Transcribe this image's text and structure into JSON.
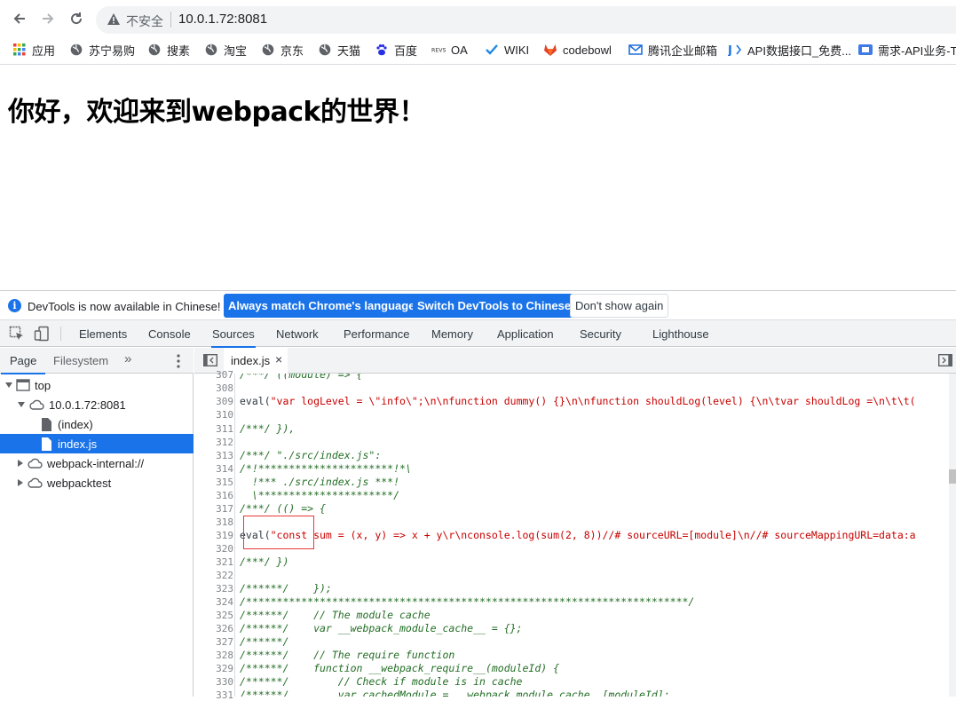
{
  "browser": {
    "security_label": "不安全",
    "url": "10.0.1.72:8081"
  },
  "bookmarks": [
    {
      "label": "应用",
      "icon": "apps-grid-icon"
    },
    {
      "label": "苏宁易购",
      "icon": "globe-icon"
    },
    {
      "label": "搜素",
      "icon": "globe-icon"
    },
    {
      "label": "淘宝",
      "icon": "globe-icon"
    },
    {
      "label": "京东",
      "icon": "globe-icon"
    },
    {
      "label": "天猫",
      "icon": "globe-icon"
    },
    {
      "label": "百度",
      "icon": "baidu-paw-icon"
    },
    {
      "label": "OA",
      "icon": "oa-logo-icon"
    },
    {
      "label": "WIKI",
      "icon": "check-logo-icon"
    },
    {
      "label": "codebowl",
      "icon": "gitlab-fox-icon"
    },
    {
      "label": "腾讯企业邮箱",
      "icon": "tencent-mail-icon"
    },
    {
      "label": "API数据接口_免费...",
      "icon": "api-logo-icon"
    },
    {
      "label": "需求-API业务-T...",
      "icon": "tapd-logo-icon"
    }
  ],
  "page": {
    "heading": "你好，欢迎来到webpack的世界！"
  },
  "devtools": {
    "banner": {
      "message": "DevTools is now available in Chinese!",
      "btn_match": "Always match Chrome's language",
      "btn_switch": "Switch DevTools to Chinese",
      "btn_dismiss": "Don't show again"
    },
    "tabs": [
      "Elements",
      "Console",
      "Sources",
      "Network",
      "Performance",
      "Memory",
      "Application",
      "Security",
      "Lighthouse"
    ],
    "active_tab": "Sources",
    "navigator": {
      "tabs": [
        "Page",
        "Filesystem"
      ],
      "more": "»",
      "tree": {
        "top": "top",
        "host": "10.0.1.72:8081",
        "index": "(index)",
        "indexjs": "index.js",
        "internal": "webpack-internal://",
        "test": "webpacktest"
      }
    },
    "editor": {
      "file_tab": "index.js",
      "close": "×",
      "lines": [
        {
          "n": "307",
          "t": "/***/ ((module) => {"
        },
        {
          "n": "308",
          "t": ""
        },
        {
          "n": "309",
          "t": "eval(\"var logLevel = \\\"info\\\";\\n\\nfunction dummy() {}\\n\\nfunction shouldLog(level) {\\n\\tvar shouldLog =\\n\\t\\t("
        },
        {
          "n": "310",
          "t": ""
        },
        {
          "n": "311",
          "t": "/***/ }),"
        },
        {
          "n": "312",
          "t": ""
        },
        {
          "n": "313",
          "t": "/***/ \"./src/index.js\":"
        },
        {
          "n": "314",
          "t": "/*!**********************!*\\"
        },
        {
          "n": "315",
          "t": "  !*** ./src/index.js ***!"
        },
        {
          "n": "316",
          "t": "  \\**********************/"
        },
        {
          "n": "317",
          "t": "/***/ (() => {"
        },
        {
          "n": "318",
          "t": ""
        },
        {
          "n": "319",
          "t": "eval(\"const sum = (x, y) => x + y\\r\\nconsole.log(sum(2, 8))//# sourceURL=[module]\\n//# sourceMappingURL=data:a"
        },
        {
          "n": "320",
          "t": ""
        },
        {
          "n": "321",
          "t": "/***/ })"
        },
        {
          "n": "322",
          "t": ""
        },
        {
          "n": "323",
          "t": "/******/    });"
        },
        {
          "n": "324",
          "t": "/************************************************************************/"
        },
        {
          "n": "325",
          "t": "/******/    // The module cache"
        },
        {
          "n": "326",
          "t": "/******/    var __webpack_module_cache__ = {};"
        },
        {
          "n": "327",
          "t": "/******/"
        },
        {
          "n": "328",
          "t": "/******/    // The require function"
        },
        {
          "n": "329",
          "t": "/******/    function __webpack_require__(moduleId) {"
        },
        {
          "n": "330",
          "t": "/******/        // Check if module is in cache"
        },
        {
          "n": "331",
          "t": "/******/        var cachedModule = __webpack_module_cache__[moduleId];"
        }
      ]
    }
  }
}
